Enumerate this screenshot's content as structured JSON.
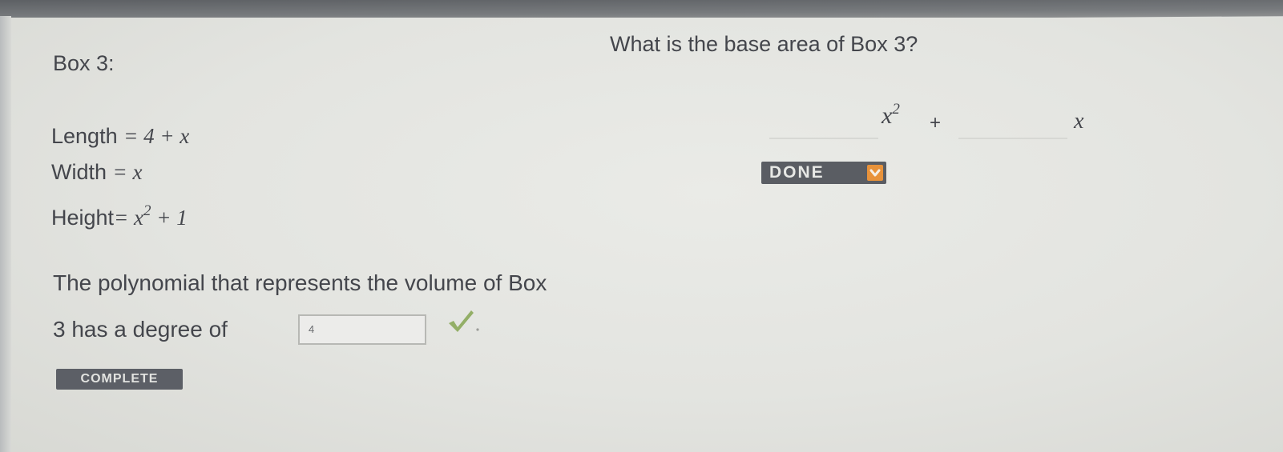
{
  "box": {
    "title": "Box 3:",
    "length_label": "Length",
    "length_expr": "= 4 + x",
    "width_label": "Width",
    "width_expr": "= x",
    "height_label": "Height",
    "height_pre": "= x",
    "height_exp": "2",
    "height_post": " + 1"
  },
  "degree_question": {
    "line1": "The polynomial that represents the volume of Box",
    "line2": "3 has a degree of",
    "answer": "4",
    "status_badge": "COMPLETE"
  },
  "base_area": {
    "question": "What is the base area of Box 3?",
    "term1_var": "x",
    "term1_exp": "2",
    "plus": "+",
    "term2_var": "x",
    "done_label": "DONE"
  },
  "colors": {
    "accent_orange": "#e8923a",
    "button_gray": "#5a5d63",
    "check_green": "#8aa85a"
  },
  "icons": {
    "check": "check-icon",
    "done": "chevron-down-icon"
  }
}
